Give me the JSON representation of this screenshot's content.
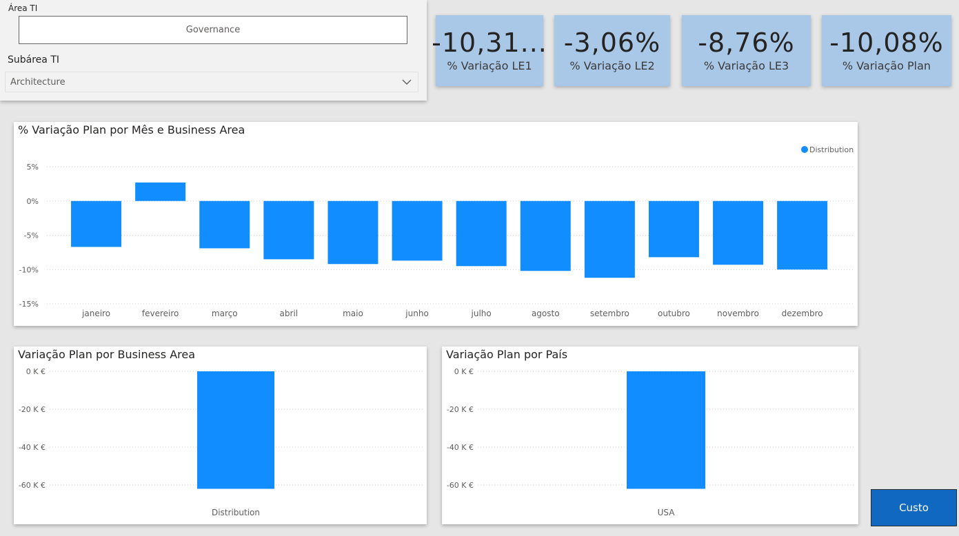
{
  "filters": {
    "area_title": "Área TI",
    "area_value": "Governance",
    "subarea_title": "Subárea TI",
    "subarea_value": "Architecture"
  },
  "kpis": [
    {
      "value": "-10,31...",
      "label": "% Variação LE1"
    },
    {
      "value": "-3,06%",
      "label": "% Variação LE2"
    },
    {
      "value": "-8,76%",
      "label": "% Variação LE3"
    },
    {
      "value": "-10,08%",
      "label": "% Variação Plan"
    }
  ],
  "button": {
    "label": "Custo"
  },
  "colors": {
    "bar": "#118dff",
    "kpi_bg": "#a9c8e8",
    "button": "#1068c0"
  },
  "chart_data": [
    {
      "type": "bar",
      "title": "% Variação Plan por Mês e Business Area",
      "legend": {
        "entries": [
          "Distribution"
        ],
        "position": "top-right"
      },
      "categories": [
        "janeiro",
        "fevereiro",
        "março",
        "abril",
        "maio",
        "junho",
        "julho",
        "agosto",
        "setembro",
        "outubro",
        "novembro",
        "dezembro"
      ],
      "series": [
        {
          "name": "Distribution",
          "values": [
            -6.7,
            2.7,
            -6.9,
            -8.5,
            -9.2,
            -8.7,
            -9.5,
            -10.2,
            -11.2,
            -8.2,
            -9.3,
            -10.0
          ]
        }
      ],
      "yticks": [
        "5%",
        "0%",
        "-5%",
        "-10%",
        "-15%"
      ],
      "ylim": [
        -15,
        5
      ],
      "grid": true
    },
    {
      "type": "bar",
      "title": "Variação Plan por Business Area",
      "categories": [
        "Distribution"
      ],
      "values": [
        -62
      ],
      "yticks": [
        "0 K €",
        "-20 K €",
        "-40 K €",
        "-60 K €"
      ],
      "ylim": [
        -60,
        0
      ],
      "grid": true
    },
    {
      "type": "bar",
      "title": "Variação Plan por País",
      "categories": [
        "USA"
      ],
      "values": [
        -62
      ],
      "yticks": [
        "0 K €",
        "-20 K €",
        "-40 K €",
        "-60 K €"
      ],
      "ylim": [
        -60,
        0
      ],
      "grid": true
    }
  ]
}
